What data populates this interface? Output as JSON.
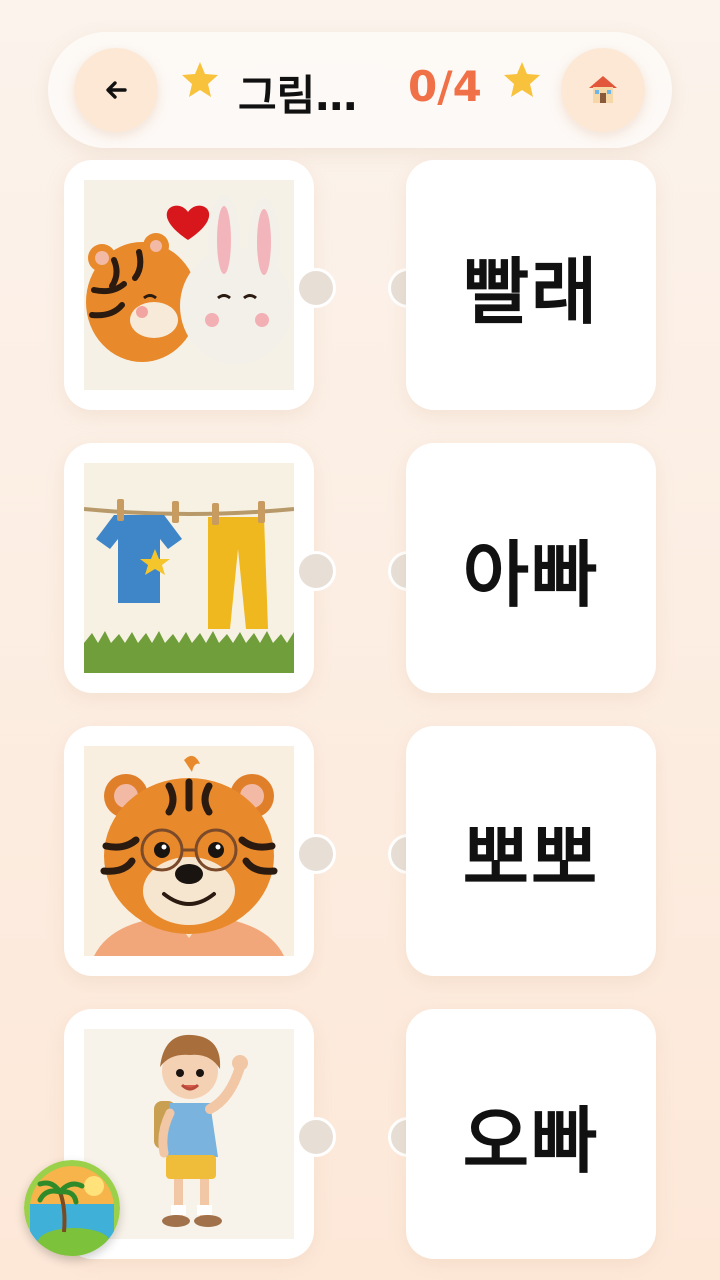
{
  "header": {
    "title": "그림…",
    "score": "0/4",
    "back_icon": "arrow-left-icon",
    "home_icon": "house-icon",
    "star_color": "#f9c23c",
    "score_color": "#f07148"
  },
  "pictures": [
    {
      "description": "tiger-kissing-bunny",
      "icon": "tiger-bunny-kiss-image"
    },
    {
      "description": "laundry-on-line",
      "icon": "laundry-image"
    },
    {
      "description": "tiger-with-glasses",
      "icon": "dad-tiger-image"
    },
    {
      "description": "waving-boy",
      "icon": "boy-image"
    }
  ],
  "words": [
    "빨래",
    "아빠",
    "뽀뽀",
    "오빠"
  ],
  "logo_icon": "island-logo-icon"
}
